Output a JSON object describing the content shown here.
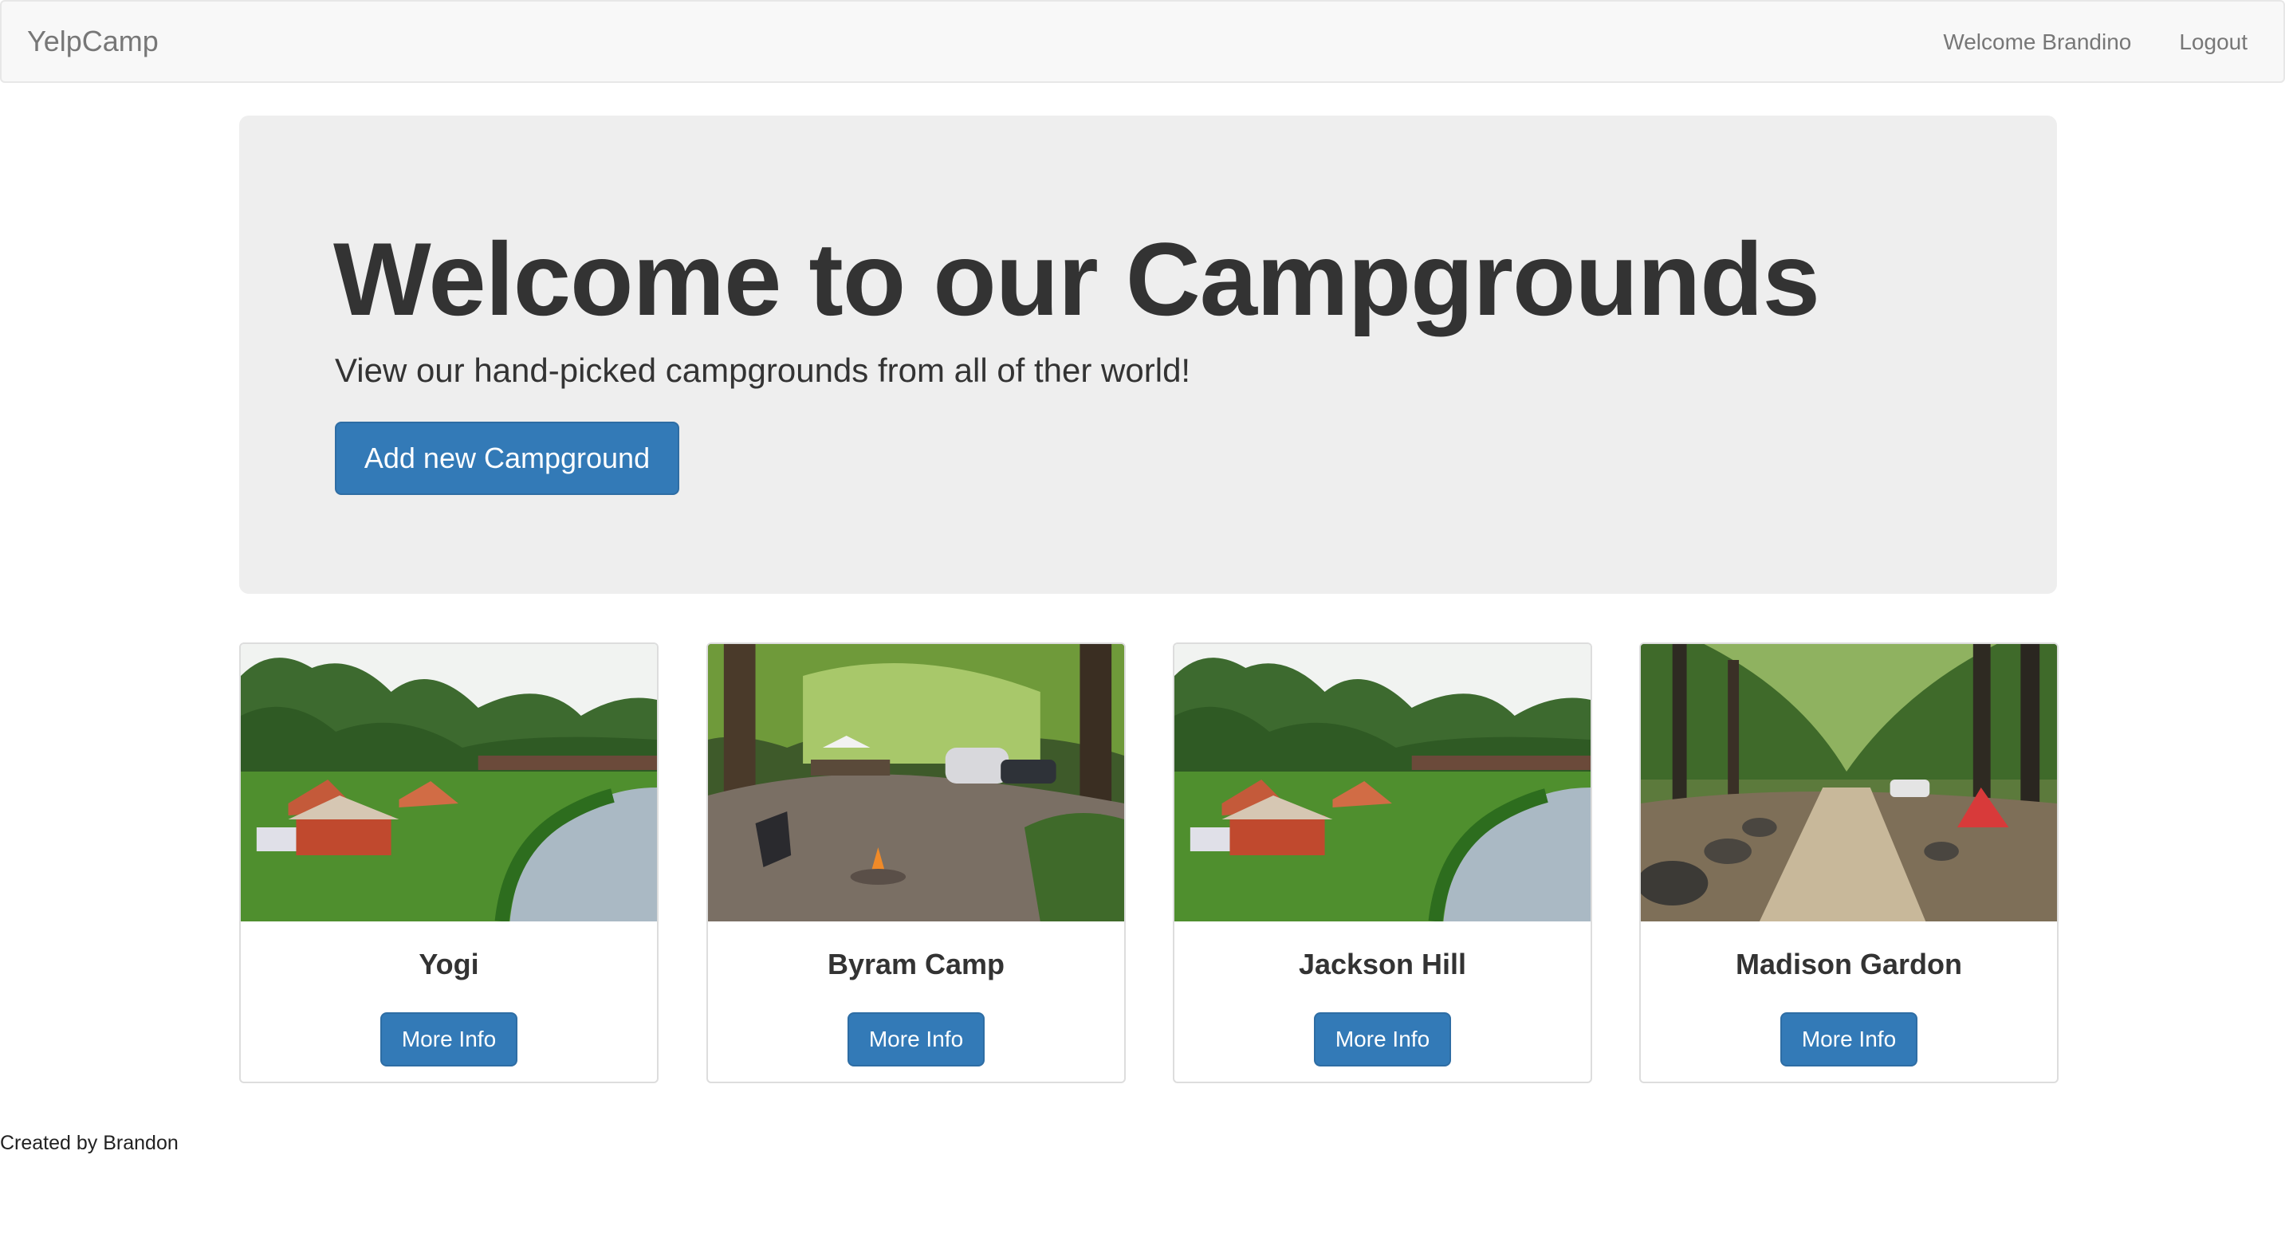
{
  "navbar": {
    "brand": "YelpCamp",
    "welcome": "Welcome Brandino",
    "logout": "Logout"
  },
  "jumbotron": {
    "heading": "Welcome to our Campgrounds",
    "subheading": "View our hand-picked campgrounds from all of ther world!",
    "add_button": "Add new Campground"
  },
  "campgrounds": [
    {
      "name": "Yogi",
      "button": "More Info",
      "image": "river-meadow-tents"
    },
    {
      "name": "Byram Camp",
      "button": "More Info",
      "image": "forest-campfire-trailer"
    },
    {
      "name": "Jackson Hill",
      "button": "More Info",
      "image": "river-meadow-tents"
    },
    {
      "name": "Madison Gardon",
      "button": "More Info",
      "image": "forest-dirt-road"
    }
  ],
  "footer": {
    "text": "Created by Brandon"
  },
  "colors": {
    "primary": "#337ab7",
    "navbar_bg": "#f8f8f8",
    "jumbotron_bg": "#eeeeee"
  }
}
